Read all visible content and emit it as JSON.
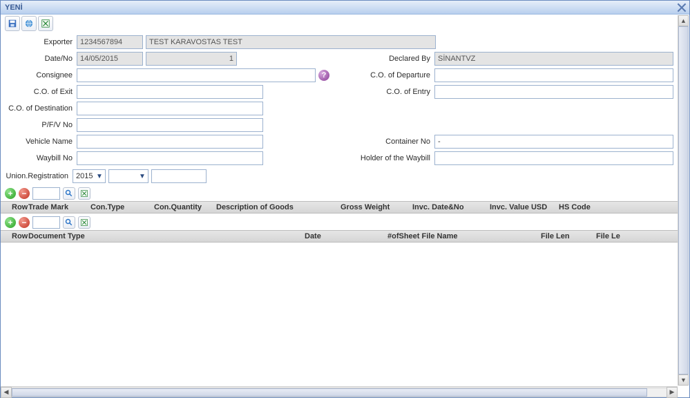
{
  "window": {
    "title": "YENİ"
  },
  "form": {
    "exporter_label": "Exporter",
    "exporter_code": "1234567894",
    "exporter_name": "TEST KARAVOSTAS TEST",
    "date_no_label": "Date/No",
    "date": "14/05/2015",
    "no": "1",
    "declared_by_label": "Declared By",
    "declared_by": "SİNANTVZ",
    "consignee_label": "Consignee",
    "consignee": "",
    "co_departure_label": "C.O. of Departure",
    "co_departure": "",
    "co_exit_label": "C.O. of Exit",
    "co_exit": "",
    "co_entry_label": "C.O. of Entry",
    "co_entry": "",
    "co_destination_label": "C.O. of Destination",
    "co_destination": "",
    "pfv_label": "P/F/V No",
    "pfv": "",
    "vehicle_label": "Vehicle Name",
    "vehicle": "",
    "container_label": "Container No",
    "container": "-",
    "waybill_label": "Waybill No",
    "waybill": "",
    "holder_label": "Holder of the Waybill",
    "holder": "",
    "union_reg_label": "Union.Registration",
    "reg_year": "2015",
    "reg_mid": "",
    "reg_num": ""
  },
  "grid1": {
    "headers": {
      "row": "Row",
      "trade_mark": "Trade Mark",
      "con_type": "Con.Type",
      "con_qty": "Con.Quantity",
      "desc": "Description of Goods",
      "gross_weight": "Gross Weight",
      "invc_dateno": "Invc. Date&No",
      "invc_value": "Invc. Value",
      "usd": "USD",
      "hs_code": "HS Code"
    }
  },
  "grid2": {
    "headers": {
      "row": "Row",
      "doc_type": "Document Type",
      "date": "Date",
      "of_sheet": "#ofSheet",
      "file_name": "File Name",
      "file_len": "File Len",
      "file_le": "File Le"
    }
  },
  "icons": {
    "help": "?"
  }
}
